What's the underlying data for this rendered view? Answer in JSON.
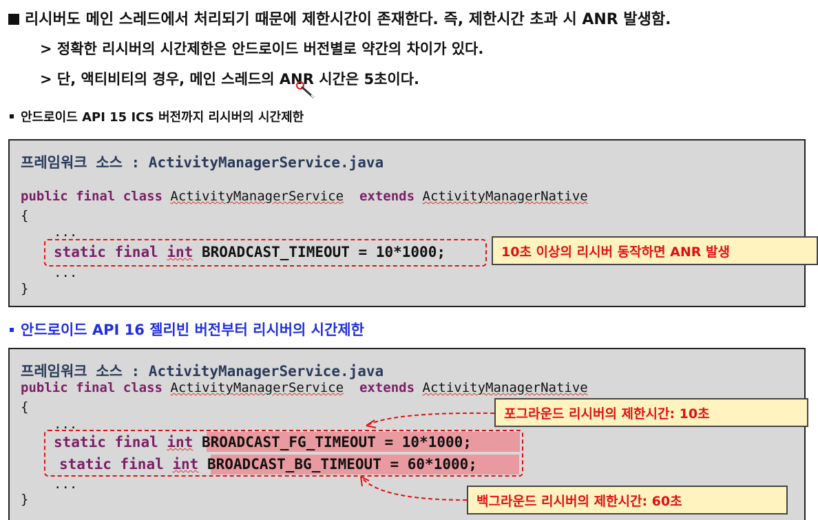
{
  "header": {
    "line1": "리시버도 메인 스레드에서 처리되기 때문에 제한시간이 존재한다. 즉, 제한시간 초과 시 ANR 발생함.",
    "line2": "> 정확한 리시버의 시간제한은 안드로이드 버전별로 약간의 차이가 있다.",
    "line3": "> 단, 액티비티의 경우, 메인 스레드의 ANR 시간은 5초이다."
  },
  "section1": {
    "heading": "안드로이드 API 15 ICS 버전까지 리시버의 시간제한",
    "source_label": "프레임워크 소스 : ActivityManagerService.java",
    "code": {
      "kw_public": "public",
      "kw_final": "final",
      "kw_class": "class",
      "class_name": "ActivityManagerService",
      "kw_extends": "extends",
      "parent": "ActivityManagerNative",
      "open_brace": "{",
      "ellipsis1": "...",
      "kw_static": "static",
      "kw_final2": "final",
      "kw_int": "int",
      "decl": "BROADCAST_TIMEOUT = 10*1000;",
      "ellipsis2": "...",
      "close_brace": "}"
    },
    "note": "10초 이상의 리시버 동작하면 ANR 발생"
  },
  "section2": {
    "heading": "안드로이드 API 16 젤리빈 버전부터 리시버의 시간제한",
    "source_label": "프레임워크 소스 : ActivityManagerService.java",
    "code": {
      "kw_public": "public",
      "kw_final": "final",
      "kw_class": "class",
      "class_name": "ActivityManagerService",
      "kw_extends": "extends",
      "parent": "ActivityManagerNative",
      "open_brace": "{",
      "ellipsis1": "...",
      "kw_static": "static",
      "kw_final2": "final",
      "kw_int": "int",
      "fg_decl": "BROADCAST_FG_TIMEOUT = 10*1000;",
      "bg_decl": "BROADCAST_BG_TIMEOUT = 60*1000;",
      "ellipsis2": "...",
      "close_brace": "}"
    },
    "note_fg": "포그라운드 리시버의 제한시간: 10초",
    "note_bg": "백그라운드 리시버의 제한시간: 60초"
  },
  "colors": {
    "red": "#e01010",
    "blue": "#1f2fe0",
    "note_bg": "#fff3c0",
    "code_bg": "#d8d8d8",
    "highlight": "#e89aa0"
  },
  "icons": {
    "cursor": "mouse-pointer-icon"
  }
}
